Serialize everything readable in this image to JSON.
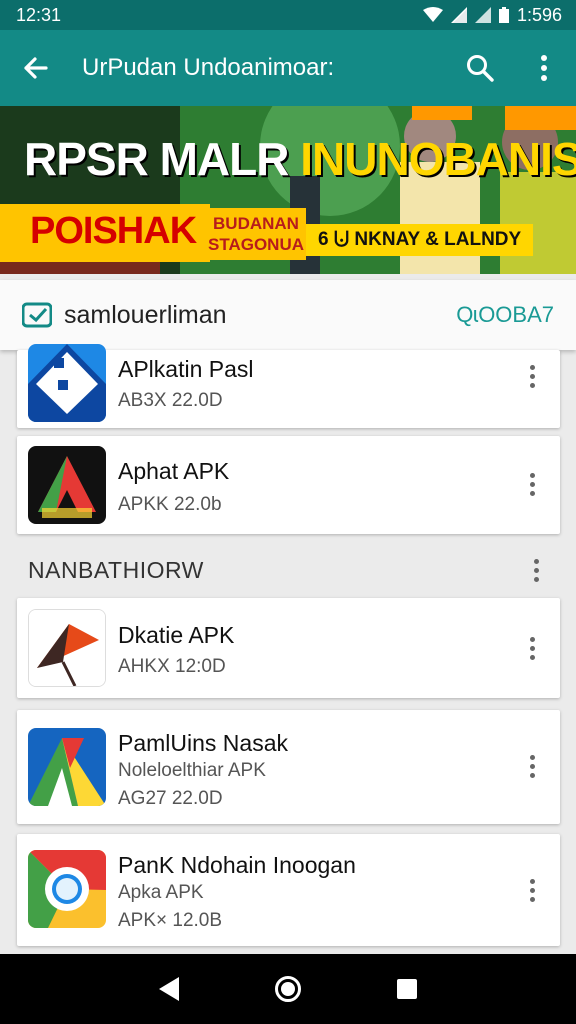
{
  "status_bar": {
    "time": "12:31",
    "battery_text": "1:596"
  },
  "app_bar": {
    "title": "UrPudan Undoanimoar:"
  },
  "banner": {
    "headline_white": "RPSR MALR ",
    "headline_yellow": "INUNOBANISA",
    "red_text": "POISHAK",
    "sub_text_line1": "BUDANAN",
    "sub_text_line2": "STAGONUA",
    "tag_text": "6 ⨃ NKNAY & LALNDY"
  },
  "search_card": {
    "label": "samlouerliman",
    "right_text": "QɩOOBA7"
  },
  "apps_top": [
    {
      "name": "APlkatin Pasl",
      "sub": "AB3X 22.0D"
    },
    {
      "name": "Aphat APK",
      "sub": "APKK 22.0b"
    }
  ],
  "section": {
    "title": "NANBATHIORW"
  },
  "apps_section": [
    {
      "name": "Dkatie APK",
      "sub": "AHKX 12:0D",
      "sub2": ""
    },
    {
      "name": "PamlUins Nasak",
      "sub": "Noleloelthiar APK",
      "sub2": "AG27 22.0D"
    },
    {
      "name": "PanK Ndohain Inoogan",
      "sub": "Apka APK",
      "sub2": "APK× 12.0B"
    }
  ],
  "icons": {
    "back": "arrow-left-icon",
    "search": "search-icon",
    "overflow": "more-vert-icon"
  },
  "colors": {
    "app_bar": "#138a86",
    "status_bar": "#0c6e6b",
    "accent": "#1a9a95"
  }
}
